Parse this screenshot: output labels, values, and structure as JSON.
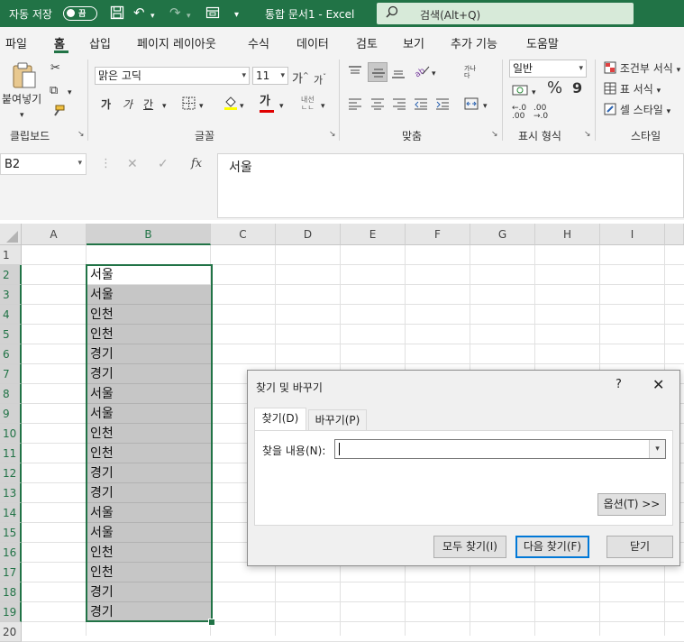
{
  "titlebar": {
    "autosave_label": "자동 저장",
    "autosave_state": "끔",
    "doc_title": "통합 문서1  -  Excel",
    "search_placeholder": "검색(Alt+Q)",
    "accent": "#217346"
  },
  "menu": {
    "tabs": [
      "파일",
      "홈",
      "삽입",
      "페이지 레이아웃",
      "수식",
      "데이터",
      "검토",
      "보기",
      "추가 기능",
      "도움말"
    ],
    "active": "홈"
  },
  "ribbon": {
    "clipboard": {
      "label": "클립보드",
      "paste": "붙여넣기"
    },
    "font": {
      "label": "글꼴",
      "font_name": "맑은 고딕",
      "font_size": "11",
      "grow": "가",
      "shrink": "가",
      "bold": "가",
      "italic": "가",
      "underline": "간",
      "color_letter": "가",
      "phonetic": "내선"
    },
    "alignment": {
      "label": "맞춤",
      "wrap": "가나\n다"
    },
    "number": {
      "label": "표시 형식",
      "format": "일반",
      "percent": "%",
      "comma": "9",
      "inc_decimal": ".00",
      "dec_decimal": ".00"
    },
    "styles": {
      "label": "스타일",
      "conditional": "조건부 서식",
      "table": "표 서식",
      "cell_styles": "셀 스타일"
    }
  },
  "formula_bar": {
    "name_box": "B2",
    "cancel": "✕",
    "enter": "✓",
    "fx": "fx",
    "value": "서울"
  },
  "sheet": {
    "columns": [
      "A",
      "B",
      "C",
      "D",
      "E",
      "F",
      "G",
      "H",
      "I"
    ],
    "selected_column": "B",
    "rows": [
      "1",
      "2",
      "3",
      "4",
      "5",
      "6",
      "7",
      "8",
      "9",
      "10",
      "11",
      "12",
      "13",
      "14",
      "15",
      "16",
      "17",
      "18",
      "19",
      "20"
    ],
    "column_b_values": [
      "",
      "서울",
      "서울",
      "인천",
      "인천",
      "경기",
      "경기",
      "서울",
      "서울",
      "인천",
      "인천",
      "경기",
      "경기",
      "서울",
      "서울",
      "인천",
      "인천",
      "경기",
      "경기",
      ""
    ]
  },
  "dialog": {
    "title": "찾기 및 바꾸기",
    "help": "?",
    "close": "✕",
    "tab_find": "찾기(D)",
    "tab_replace": "바꾸기(P)",
    "find_label": "찾을 내용(N):",
    "find_value": "",
    "options_button": "옵션(T) >>",
    "find_all_button": "모두 찾기(I)",
    "find_next_button": "다음 찾기(F)",
    "close_button": "닫기"
  }
}
